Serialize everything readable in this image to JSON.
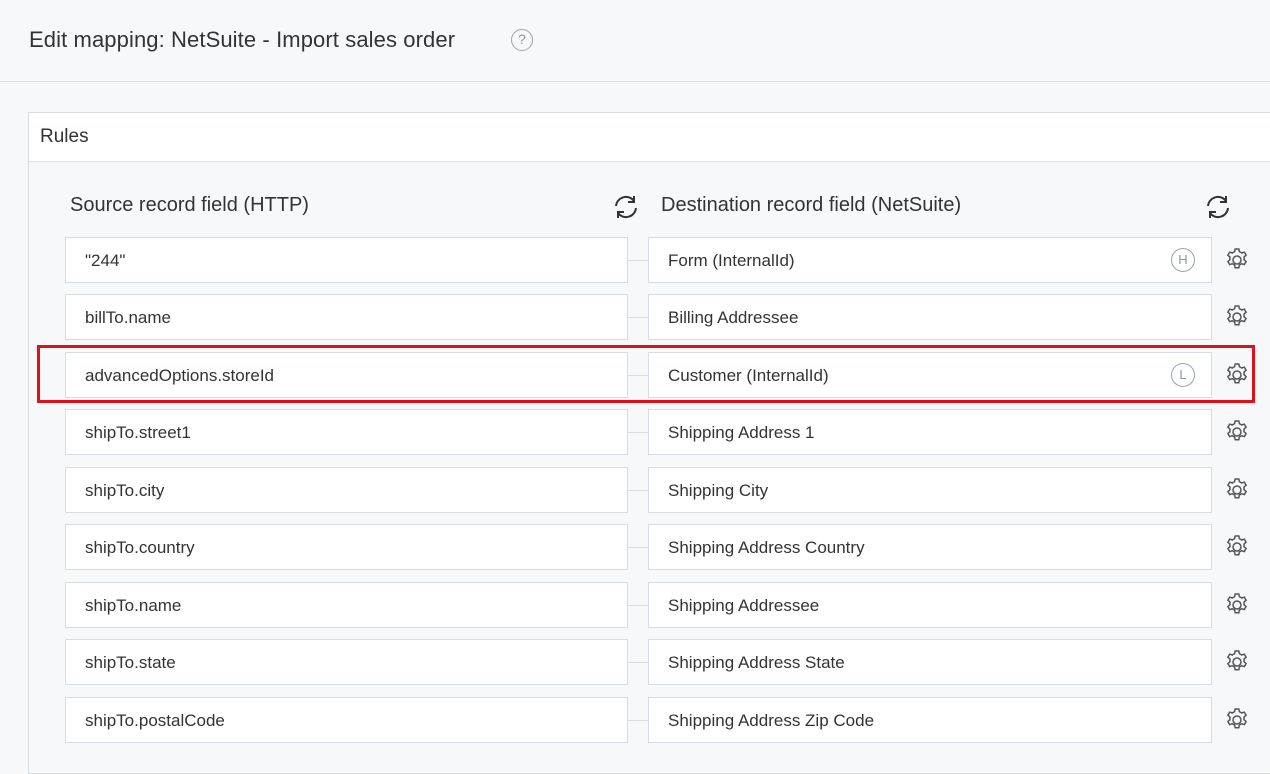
{
  "header": {
    "title": "Edit mapping: NetSuite - Import sales order",
    "help_icon": "?"
  },
  "panel": {
    "title": "Rules"
  },
  "columns": {
    "source_label": "Source record field (HTTP)",
    "destination_label": "Destination record field (NetSuite)"
  },
  "rows": [
    {
      "source": "\"244\"",
      "destination": "Form (InternalId)",
      "badge": "H"
    },
    {
      "source": "billTo.name",
      "destination": "Billing Addressee",
      "badge": ""
    },
    {
      "source": "advancedOptions.storeId",
      "destination": "Customer (InternalId)",
      "badge": "L"
    },
    {
      "source": "shipTo.street1",
      "destination": "Shipping Address 1",
      "badge": ""
    },
    {
      "source": "shipTo.city",
      "destination": "Shipping City",
      "badge": ""
    },
    {
      "source": "shipTo.country",
      "destination": "Shipping Address Country",
      "badge": ""
    },
    {
      "source": "shipTo.name",
      "destination": "Shipping Addressee",
      "badge": ""
    },
    {
      "source": "shipTo.state",
      "destination": "Shipping Address State",
      "badge": ""
    },
    {
      "source": "shipTo.postalCode",
      "destination": "Shipping Address Zip Code",
      "badge": ""
    }
  ],
  "highlight_color": "#e0101a",
  "icons": {
    "refresh": "refresh-icon",
    "settings": "gear-icon",
    "help": "help-icon"
  }
}
